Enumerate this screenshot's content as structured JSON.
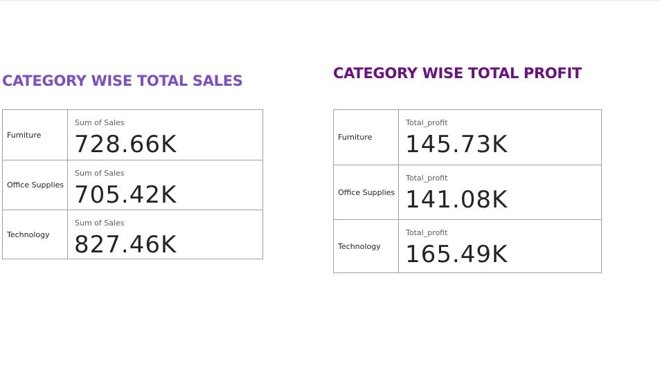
{
  "sales_visual": {
    "title": "CATEGORY WISE TOTAL SALES",
    "title_color": "#7a4fc4",
    "rows": [
      {
        "category": "Furniture",
        "label": "Sum of Sales",
        "value": "728.66K"
      },
      {
        "category": "Office Supplies",
        "label": "Sum of Sales",
        "value": "705.42K"
      },
      {
        "category": "Technology",
        "label": "Sum of Sales",
        "value": "827.46K"
      }
    ]
  },
  "profit_visual": {
    "title": "CATEGORY WISE TOTAL PROFIT",
    "title_color": "#6a1282",
    "rows": [
      {
        "category": "Furniture",
        "label": "Total_profit",
        "value": "145.73K"
      },
      {
        "category": "Office Supplies",
        "label": "Total_profit",
        "value": "141.08K"
      },
      {
        "category": "Technology",
        "label": "Total_profit",
        "value": "165.49K"
      }
    ]
  }
}
